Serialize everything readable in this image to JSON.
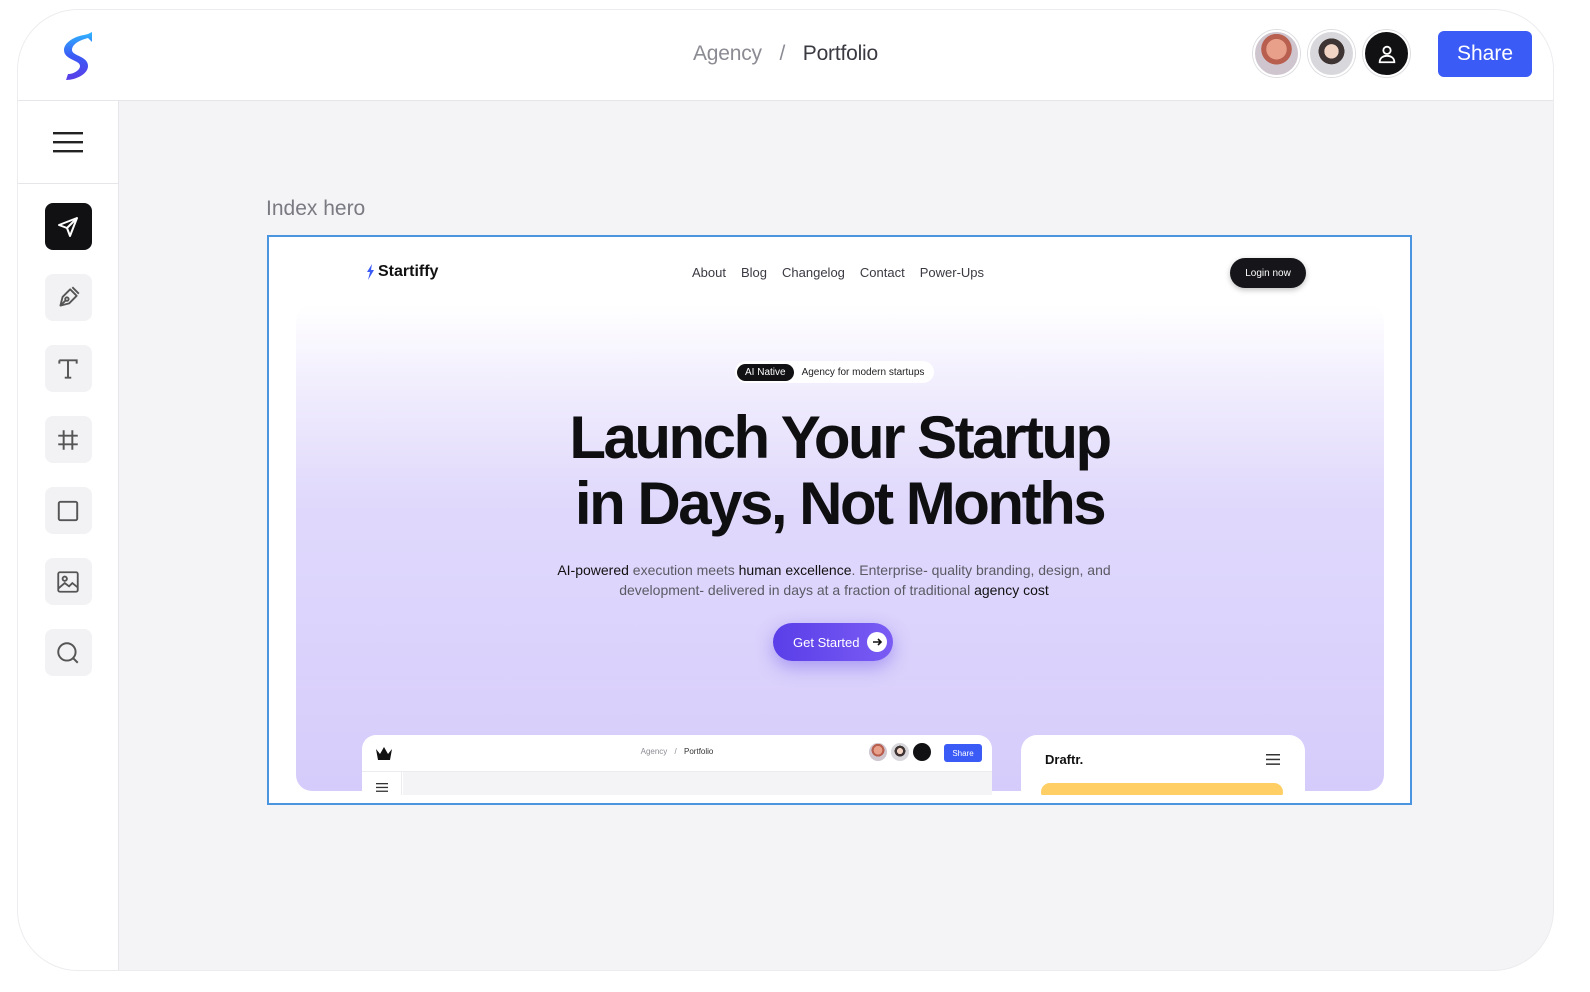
{
  "header": {
    "breadcrumb": [
      "Agency",
      "Portfolio"
    ],
    "breadcrumb_separator": "/",
    "share_label": "Share"
  },
  "sidebar": {
    "menu_icon": "hamburger-menu-icon",
    "tools": [
      {
        "name": "move",
        "icon": "send-arrow-icon",
        "active": true
      },
      {
        "name": "pen",
        "icon": "pen-nib-icon",
        "active": false
      },
      {
        "name": "text",
        "icon": "text-t-icon",
        "active": false
      },
      {
        "name": "frame",
        "icon": "hash-grid-icon",
        "active": false
      },
      {
        "name": "rectangle",
        "icon": "square-icon",
        "active": false
      },
      {
        "name": "image",
        "icon": "image-icon",
        "active": false
      },
      {
        "name": "search",
        "icon": "search-icon",
        "active": false
      }
    ]
  },
  "canvas": {
    "frame_label": "Index hero",
    "site": {
      "brand": "Startiffy",
      "nav": [
        "About",
        "Blog",
        "Changelog",
        "Contact",
        "Power-Ups"
      ],
      "login_label": "Login now",
      "badge_pill": "AI Native",
      "badge_text": "Agency for modern startups",
      "headline_line1": "Launch Your Startup",
      "headline_line2": "in Days, Not Months",
      "sub_1": "AI-powered",
      "sub_2": " execution meets ",
      "sub_3": "human excellence",
      "sub_4": ". Enterprise- quality branding, design, and development- delivered in days at a fraction of traditional ",
      "sub_5": "agency cost",
      "cta_label": "Get Started",
      "preview": {
        "crumb1": "Agency",
        "sep": "/",
        "crumb2": "Portfolio",
        "share_label": "Share"
      },
      "card_brand": "Draftr."
    }
  },
  "colors": {
    "accent": "#3b5bf6",
    "cta": "#5a3ee8",
    "frame_selection": "#4a94e0",
    "dark": "#111114"
  }
}
